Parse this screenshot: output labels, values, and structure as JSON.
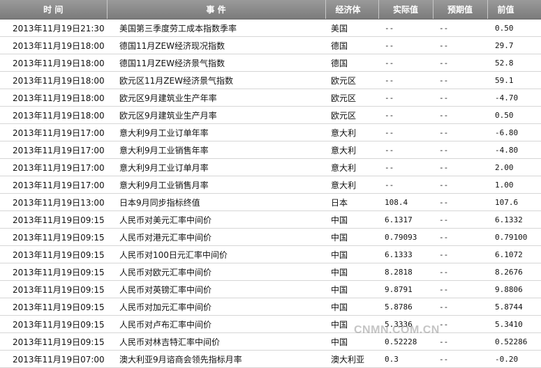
{
  "headers": {
    "time": "时 间",
    "event": "事 件",
    "country": "经济体",
    "actual": "实际值",
    "expected": "预期值",
    "previous": "前值"
  },
  "rows": [
    {
      "time": "2013年11月19日21:30",
      "event": "美国第三季度劳工成本指数季率",
      "country": "美国",
      "actual": "--",
      "expected": "--",
      "previous": "0.50"
    },
    {
      "time": "2013年11月19日18:00",
      "event": "德国11月ZEW经济现况指数",
      "country": "德国",
      "actual": "--",
      "expected": "--",
      "previous": "29.7"
    },
    {
      "time": "2013年11月19日18:00",
      "event": "德国11月ZEW经济景气指数",
      "country": "德国",
      "actual": "--",
      "expected": "--",
      "previous": "52.8"
    },
    {
      "time": "2013年11月19日18:00",
      "event": "欧元区11月ZEW经济景气指数",
      "country": "欧元区",
      "actual": "--",
      "expected": "--",
      "previous": "59.1"
    },
    {
      "time": "2013年11月19日18:00",
      "event": "欧元区9月建筑业生产年率",
      "country": "欧元区",
      "actual": "--",
      "expected": "--",
      "previous": "-4.70"
    },
    {
      "time": "2013年11月19日18:00",
      "event": "欧元区9月建筑业生产月率",
      "country": "欧元区",
      "actual": "--",
      "expected": "--",
      "previous": "0.50"
    },
    {
      "time": "2013年11月19日17:00",
      "event": "意大利9月工业订单年率",
      "country": "意大利",
      "actual": "--",
      "expected": "--",
      "previous": "-6.80"
    },
    {
      "time": "2013年11月19日17:00",
      "event": "意大利9月工业销售年率",
      "country": "意大利",
      "actual": "--",
      "expected": "--",
      "previous": "-4.80"
    },
    {
      "time": "2013年11月19日17:00",
      "event": "意大利9月工业订单月率",
      "country": "意大利",
      "actual": "--",
      "expected": "--",
      "previous": "2.00"
    },
    {
      "time": "2013年11月19日17:00",
      "event": "意大利9月工业销售月率",
      "country": "意大利",
      "actual": "--",
      "expected": "--",
      "previous": "1.00"
    },
    {
      "time": "2013年11月19日13:00",
      "event": "日本9月同步指标终值",
      "country": "日本",
      "actual": "108.4",
      "expected": "--",
      "previous": "107.6"
    },
    {
      "time": "2013年11月19日09:15",
      "event": "人民币对美元汇率中间价",
      "country": "中国",
      "actual": "6.1317",
      "expected": "--",
      "previous": "6.1332"
    },
    {
      "time": "2013年11月19日09:15",
      "event": "人民币对港元汇率中间价",
      "country": "中国",
      "actual": "0.79093",
      "expected": "--",
      "previous": "0.79100"
    },
    {
      "time": "2013年11月19日09:15",
      "event": "人民币对100日元汇率中间价",
      "country": "中国",
      "actual": "6.1333",
      "expected": "--",
      "previous": "6.1072"
    },
    {
      "time": "2013年11月19日09:15",
      "event": "人民币对欧元汇率中间价",
      "country": "中国",
      "actual": "8.2818",
      "expected": "--",
      "previous": "8.2676"
    },
    {
      "time": "2013年11月19日09:15",
      "event": "人民币对英镑汇率中间价",
      "country": "中国",
      "actual": "9.8791",
      "expected": "--",
      "previous": "9.8806"
    },
    {
      "time": "2013年11月19日09:15",
      "event": "人民币对加元汇率中间价",
      "country": "中国",
      "actual": "5.8786",
      "expected": "--",
      "previous": "5.8744"
    },
    {
      "time": "2013年11月19日09:15",
      "event": "人民币对卢布汇率中间价",
      "country": "中国",
      "actual": "5.3336",
      "expected": "--",
      "previous": "5.3410"
    },
    {
      "time": "2013年11月19日09:15",
      "event": "人民币对林吉特汇率中间价",
      "country": "中国",
      "actual": "0.52228",
      "expected": "--",
      "previous": "0.52286"
    },
    {
      "time": "2013年11月19日07:00",
      "event": "澳大利亚9月谘商会领先指标月率",
      "country": "澳大利亚",
      "actual": "0.3",
      "expected": "--",
      "previous": "-0.20"
    }
  ],
  "watermark": "CNMN.COM.CN"
}
